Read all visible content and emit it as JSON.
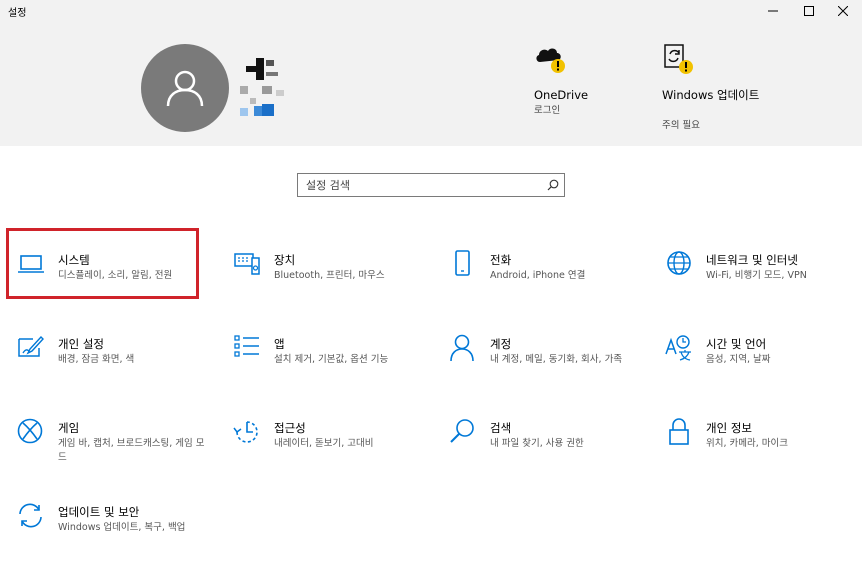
{
  "window": {
    "title": "설정",
    "controls": [
      "minimize",
      "maximize",
      "close"
    ]
  },
  "header": {
    "onedrive": {
      "label": "OneDrive",
      "sub": "로그인",
      "icon": "onedrive-warning-icon"
    },
    "windows_update": {
      "label": "Windows 업데이트",
      "sub": "주의 필요",
      "icon": "update-warning-icon"
    }
  },
  "search": {
    "placeholder": "설정 검색",
    "icon": "search-icon"
  },
  "accent_color": "#0078d7",
  "highlight_color": "#d0232a",
  "items": [
    {
      "title": "시스템",
      "desc": "디스플레이, 소리, 알림, 전원",
      "icon": "laptop-icon"
    },
    {
      "title": "장치",
      "desc": "Bluetooth, 프린터, 마우스",
      "icon": "devices-icon"
    },
    {
      "title": "전화",
      "desc": "Android, iPhone 연결",
      "icon": "phone-icon"
    },
    {
      "title": "네트워크 및 인터넷",
      "desc": "Wi-Fi, 비행기 모드, VPN",
      "icon": "globe-icon"
    },
    {
      "title": "개인 설정",
      "desc": "배경, 잠금 화면, 색",
      "icon": "personalization-icon"
    },
    {
      "title": "앱",
      "desc": "설치 제거, 기본값, 옵션 기능",
      "icon": "apps-list-icon"
    },
    {
      "title": "계정",
      "desc": "내 계정, 메일, 동기화, 회사, 가족",
      "icon": "person-icon"
    },
    {
      "title": "시간 및 언어",
      "desc": "음성, 지역, 날짜",
      "icon": "time-language-icon"
    },
    {
      "title": "게임",
      "desc": "게임 바, 캡처, 브로드캐스팅, 게임 모드",
      "icon": "xbox-icon"
    },
    {
      "title": "접근성",
      "desc": "내레이터, 돋보기, 고대비",
      "icon": "ease-of-access-icon"
    },
    {
      "title": "검색",
      "desc": "내 파일 찾기, 사용 권한",
      "icon": "search-magnifier-icon"
    },
    {
      "title": "개인 정보",
      "desc": "위치, 카메라, 마이크",
      "icon": "lock-icon"
    },
    {
      "title": "업데이트 및 보안",
      "desc": "Windows 업데이트, 복구, 백업",
      "icon": "sync-icon"
    }
  ]
}
